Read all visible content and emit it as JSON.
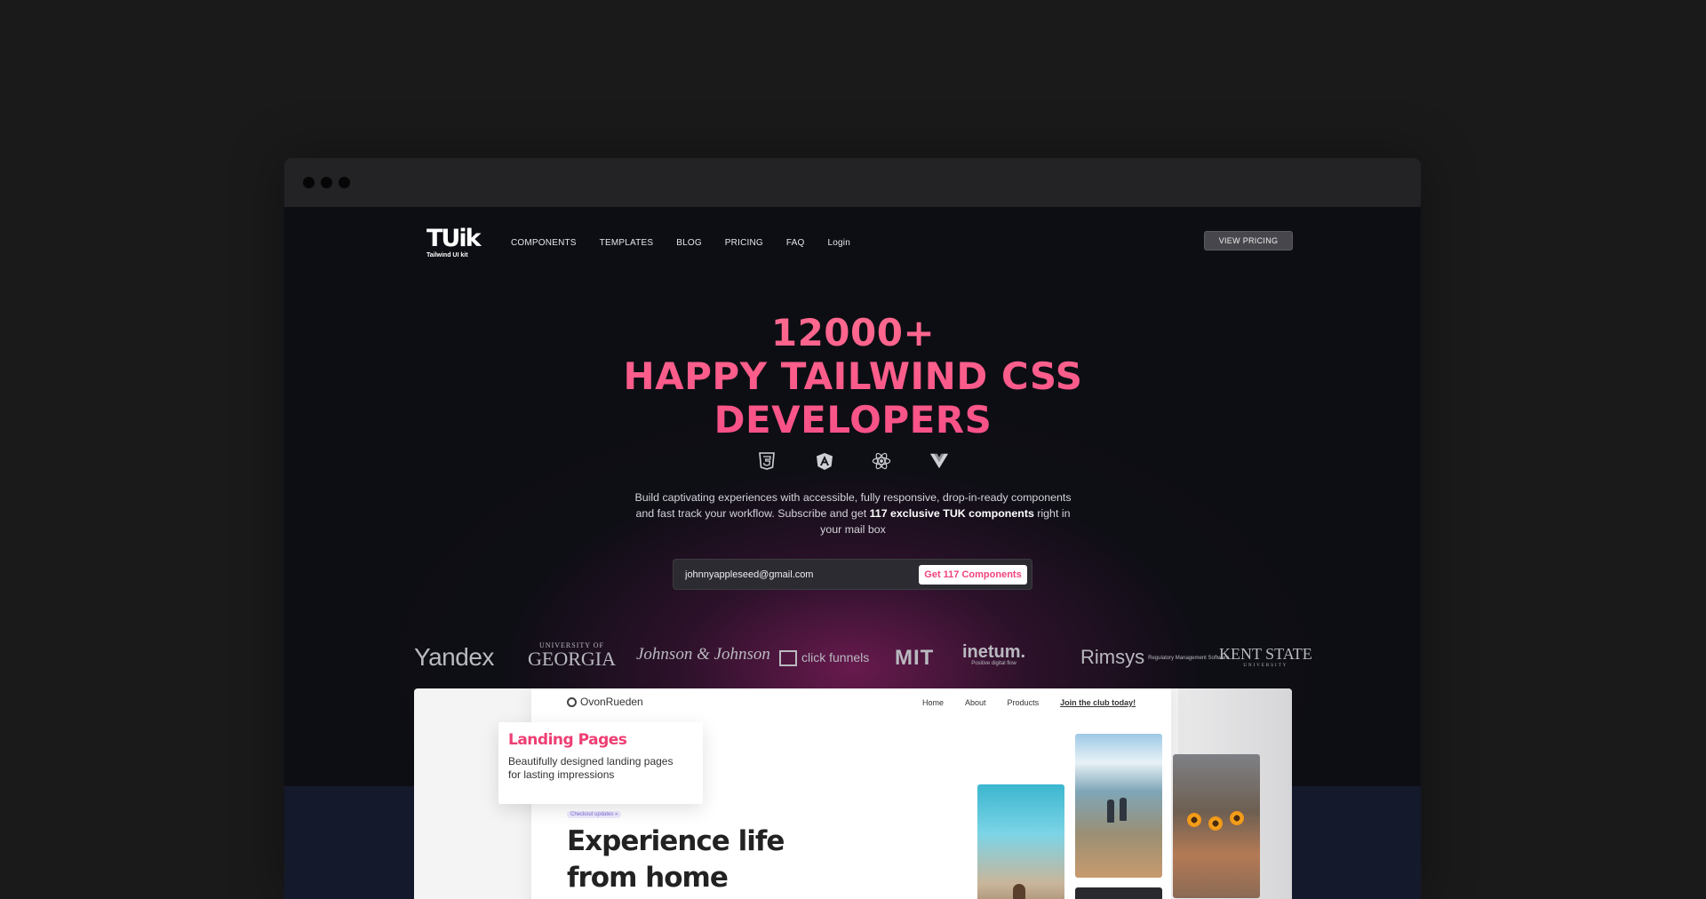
{
  "window": {
    "dots": 3
  },
  "nav": {
    "logo_mark": "TUik",
    "logo_sub": "Tailwind UI kit",
    "links": [
      "COMPONENTS",
      "TEMPLATES",
      "BLOG",
      "PRICING",
      "FAQ",
      "Login"
    ],
    "cta": "VIEW PRICING"
  },
  "hero": {
    "line1": "12000+",
    "line2": "HAPPY TAILWIND CSS",
    "line3": "DEVELOPERS",
    "tech_icons": [
      "html5-icon",
      "angular-icon",
      "react-icon",
      "vue-icon"
    ],
    "desc_pre": "Build captivating experiences with accessible, fully responsive, drop-in-ready components and fast track your workflow. Subscribe and get ",
    "desc_bold": "117 exclusive TUK components",
    "desc_post": " right in your mail box",
    "email_value": "johnnyappleseed@gmail.com",
    "submit_label": "Get 117 Components",
    "accent": "#f74f87"
  },
  "clients": {
    "yandex": "Yandex",
    "uga_small": "UNIVERSITY OF",
    "uga_big": "GEORGIA",
    "jj": "Johnson & Johnson",
    "clickfunnels": "click funnels",
    "mit": "MIT",
    "inetum": "inetum.",
    "inetum_sub": "Positive digital flow",
    "rimsys": "Rimsys",
    "rimsys_sub": "Regulatory Management Software",
    "kent": "KENT STATE",
    "kent_sub": "UNIVERSITY"
  },
  "preview": {
    "brand": "OvonRueden",
    "nav": [
      "Home",
      "About",
      "Products"
    ],
    "nav_cta": "Join the club today!",
    "badge": "Checkout updates  »",
    "headline_1": "Experience life",
    "headline_2": "from home",
    "card_title": "Landing Pages",
    "card_sub_1": "Beautifully designed landing pages",
    "card_sub_2": "for lasting impressions"
  }
}
